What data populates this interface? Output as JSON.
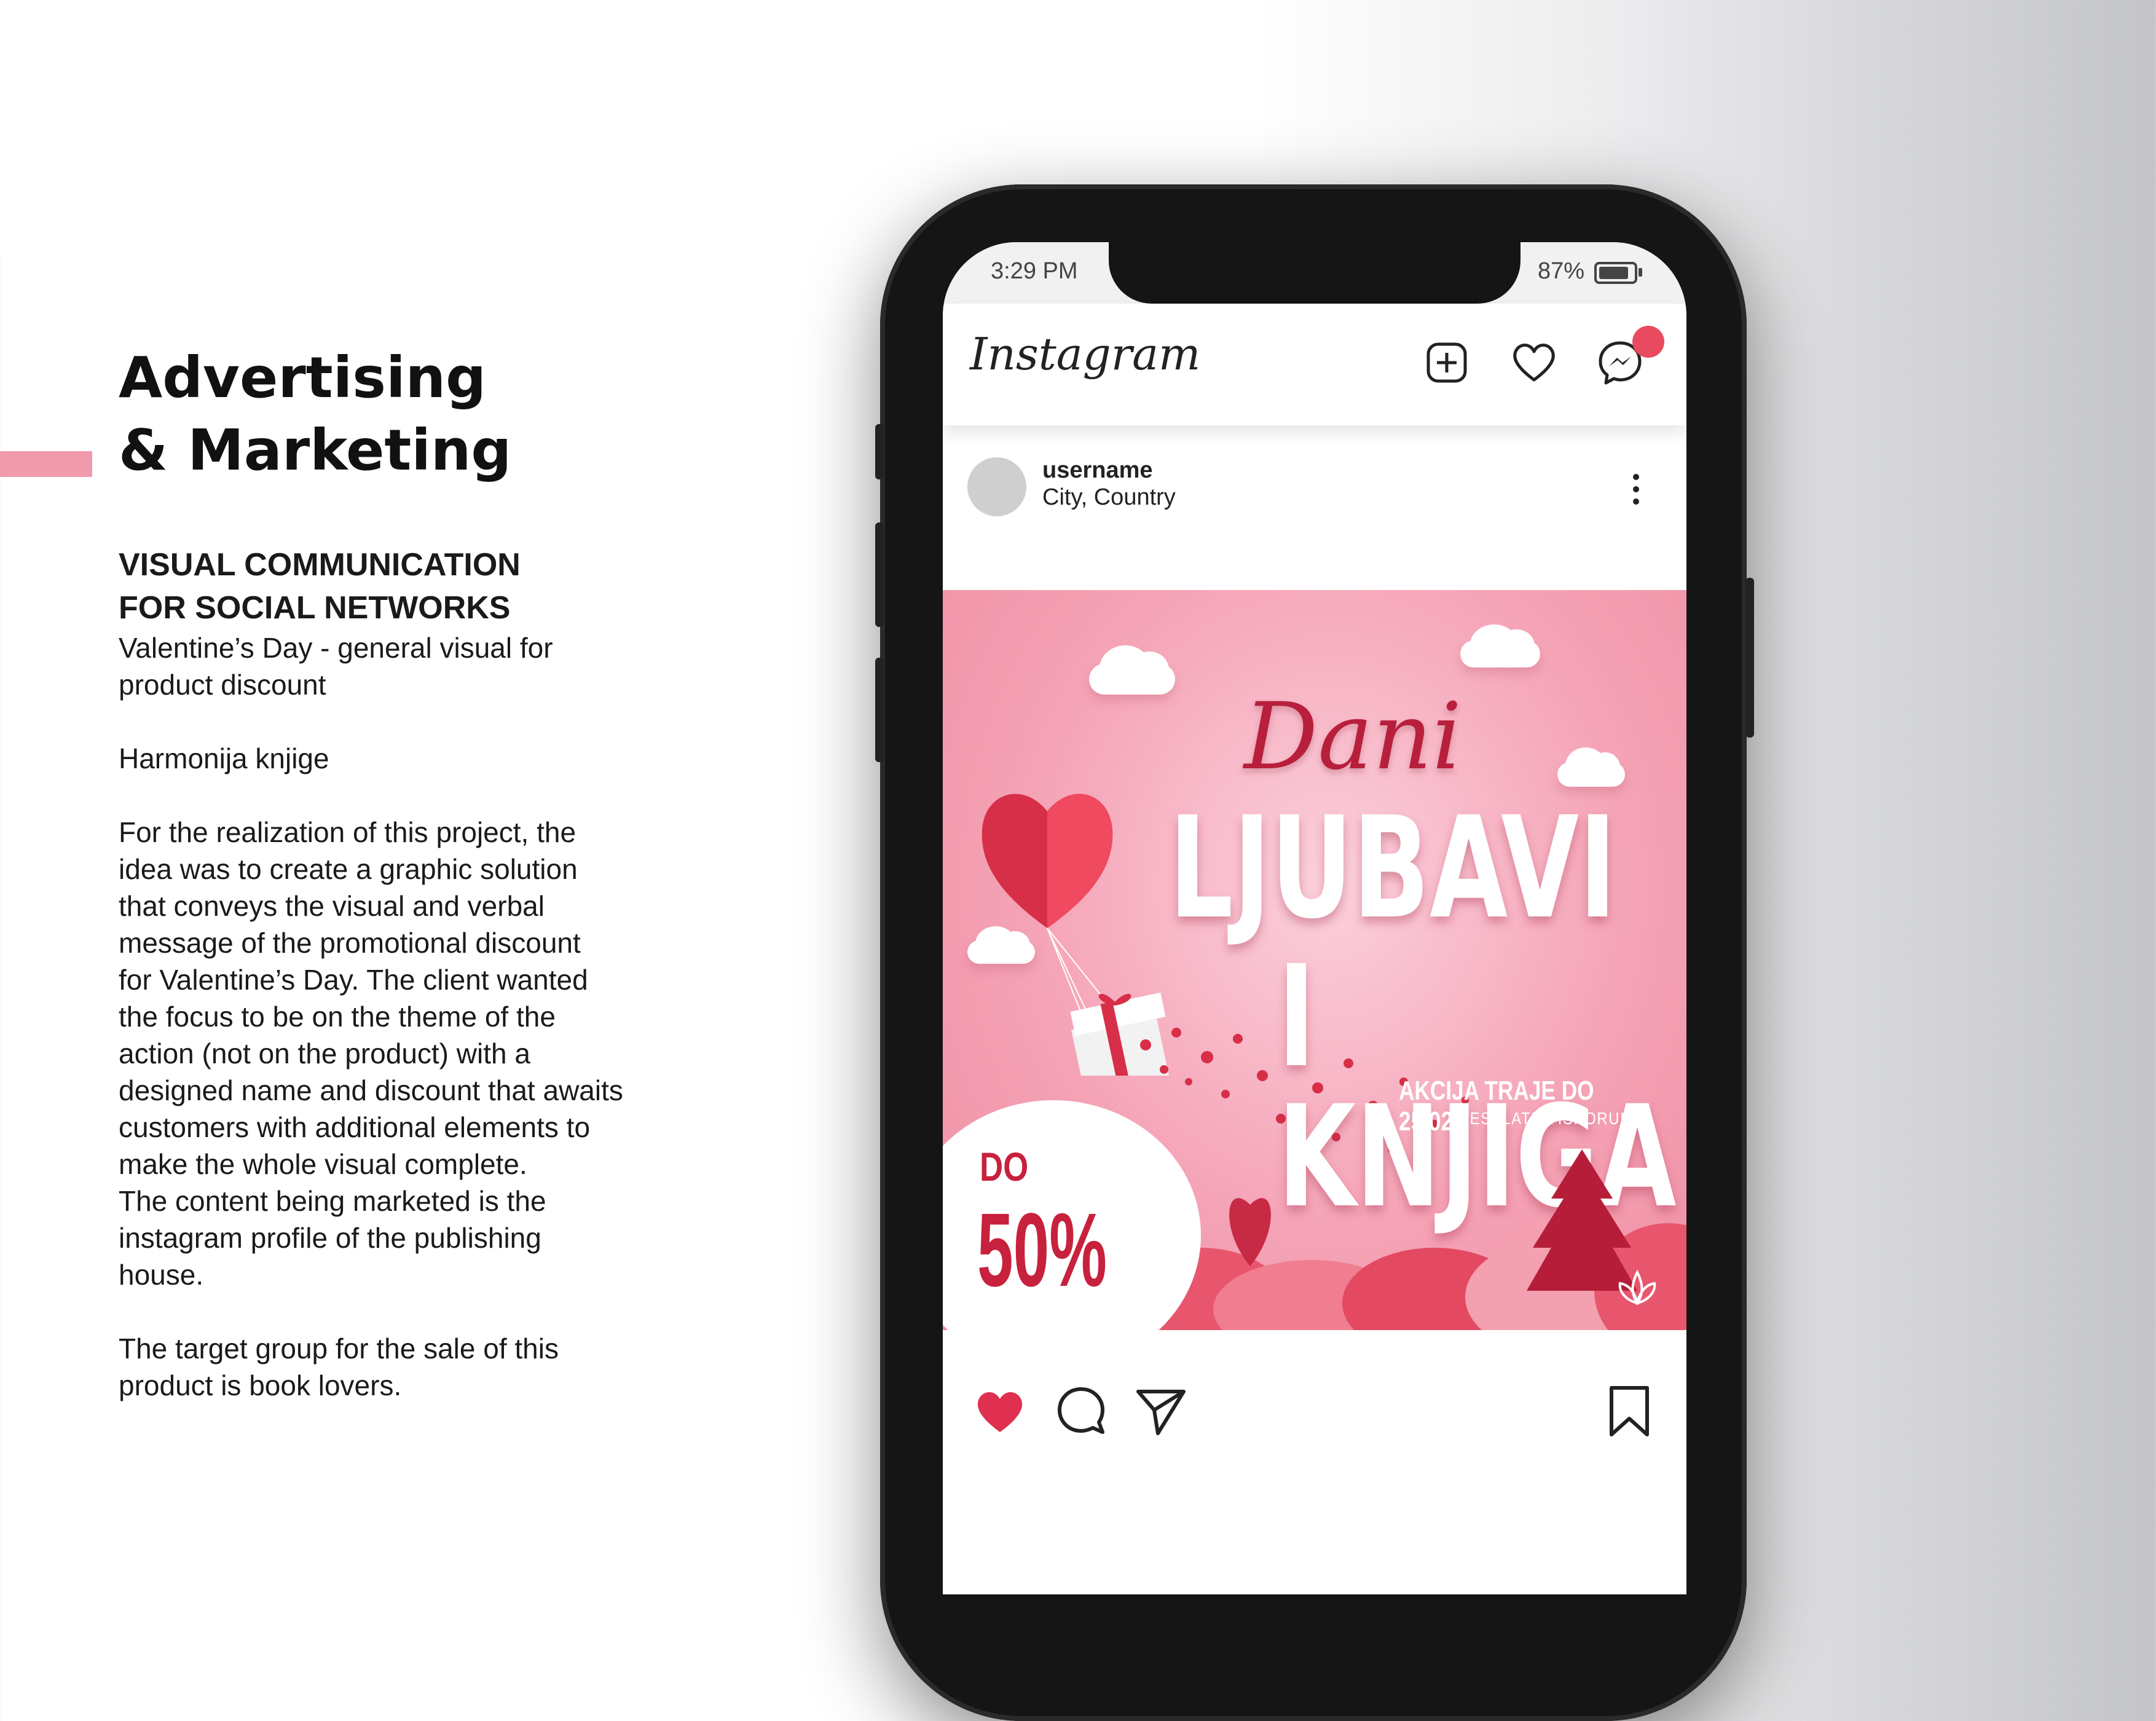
{
  "left_panel": {
    "heading_line1": "Advertising",
    "heading_line2": "& Marketing",
    "subheading_line1": "VISUAL COMMUNICATION",
    "subheading_line2": "FOR SOCIAL NETWORKS",
    "description_line1": "Valentine’s Day - general visual for",
    "description_line2": "product discount",
    "client": "Harmonija knjige",
    "body_lines": [
      "For the realization of this project, the",
      "idea was to create a graphic solution",
      "that conveys the visual and verbal",
      "message of the promotional discount",
      "for Valentine’s Day. The client wanted",
      "the focus to be on the theme of the",
      "action (not on the product) with a",
      "designed name and discount that awaits",
      "customers with additional elements to",
      "make the whole visual complete.",
      "The content being marketed is the",
      "instagram profile of the publishing",
      "house."
    ],
    "target_line1": "The target group for the sale of this",
    "target_line2": "product is book lovers."
  },
  "phone": {
    "status": {
      "time": "3:29 PM",
      "battery": "87%",
      "battery_level": 0.87
    },
    "app": {
      "logo": "Instagram",
      "icons": [
        "new-post-icon",
        "heart-icon",
        "messenger-icon"
      ],
      "notification_color": "#e84a5f"
    },
    "post": {
      "username": "username",
      "location": "City, Country",
      "image_text": {
        "line1": "Dani",
        "line2": "LJUBAVI",
        "line3": "I KNJIGA",
        "line4": "AKCIJA TRAJE DO 25.02.",
        "line5": "BESPLATNA ISPORUKA",
        "discount_prefix": "DO",
        "discount": "50%"
      },
      "actions": [
        "liked-heart-icon",
        "comment-icon",
        "share-icon",
        "bookmark-icon"
      ],
      "like_color": "#e0304f"
    }
  },
  "colors": {
    "accent": "#f19aab",
    "brand_red": "#c8213d"
  }
}
